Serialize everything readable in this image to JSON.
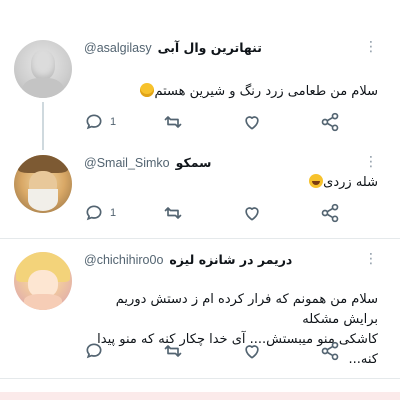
{
  "tweets": [
    {
      "username": "@asalgilasy",
      "display_name": "تنهاترین وال آبی",
      "text": "سلام من طعامی زرد رنگ و شیرین هستم",
      "emoji": "yellow-heart-emoji",
      "reply_count": "1",
      "retweet_count": "",
      "like_count": ""
    },
    {
      "username": "@Smail_Simko",
      "display_name": "سمکو",
      "text": "شله زردی",
      "emoji": "laughing-emoji",
      "reply_count": "1",
      "retweet_count": "",
      "like_count": ""
    },
    {
      "username": "@chichihiro0o",
      "display_name": "دریمر در شانزه لیزه",
      "text_line1": "سلام من همونم که فرار کرده ام ز دستش دوریم برایش مشکله",
      "text_line2": "کاشکی منو میبستش.... آی خدا چکار کنه که منو پیدا کنه...",
      "reply_count": "",
      "retweet_count": "",
      "like_count": ""
    }
  ],
  "more_glyph": "⋮",
  "colors": {
    "icon": "#536471",
    "divider": "#e5e9eb",
    "thread_line": "#cfd9de"
  }
}
